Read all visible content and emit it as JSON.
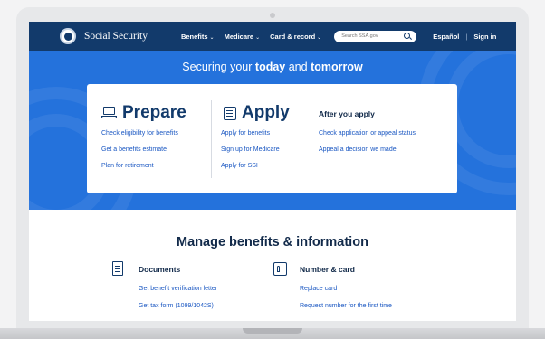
{
  "navbar": {
    "brand": "Social Security",
    "items": [
      {
        "label": "Benefits",
        "has_dropdown": true
      },
      {
        "label": "Medicare",
        "has_dropdown": true
      },
      {
        "label": "Card & record",
        "has_dropdown": true
      }
    ],
    "search": {
      "placeholder": "Search SSA.gov",
      "value": ""
    },
    "language": "Español",
    "separator": "|",
    "sign_in": "Sign in"
  },
  "hero": {
    "title_start": "Securing your ",
    "title_today": "today",
    "title_mid": " and ",
    "title_tomorrow": "tomorrow",
    "prepare": {
      "title": "Prepare",
      "icon": "laptop-icon",
      "links": [
        "Check eligibility for benefits",
        "Get a benefits estimate",
        "Plan for retirement"
      ]
    },
    "apply": {
      "title": "Apply",
      "icon": "form-icon",
      "links": [
        "Apply for benefits",
        "Sign up for Medicare",
        "Apply for SSI"
      ]
    },
    "after": {
      "title": "After you apply",
      "links": [
        "Check application or appeal status",
        "Appeal a decision we made"
      ]
    }
  },
  "manage": {
    "title": "Manage benefits & information",
    "documents": {
      "title": "Documents",
      "icon": "document-icon",
      "links": [
        "Get benefit verification letter",
        "Get tax form (1099/1042S)"
      ]
    },
    "number_card": {
      "title": "Number & card",
      "icon": "card-icon",
      "links": [
        "Replace card",
        "Request number for the first time"
      ]
    }
  },
  "colors": {
    "navbar": "#123a6b",
    "hero": "#2472dc",
    "link": "#1a57c2",
    "heading": "#122a4a"
  }
}
